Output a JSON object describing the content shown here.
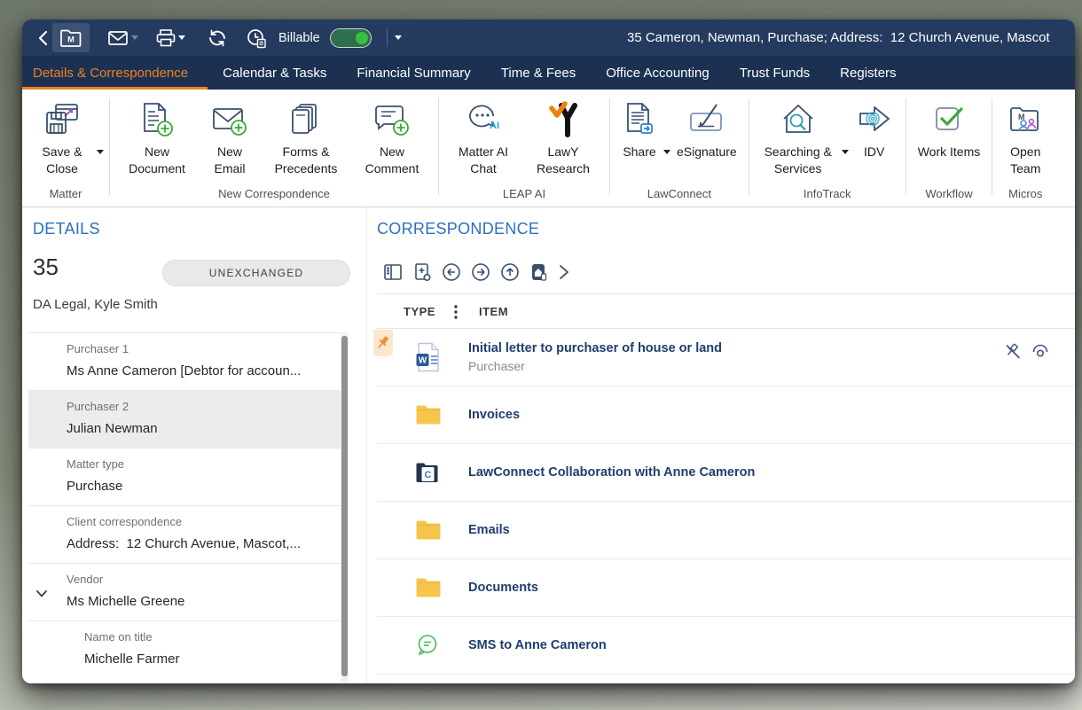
{
  "window": {
    "title": "35 Cameron, Newman, Purchase; Address:  12 Church Avenue, Mascot"
  },
  "titlebar": {
    "billable_label": "Billable",
    "billable_on": true,
    "icons": [
      "back-icon",
      "matter-folder-icon",
      "email-icon",
      "print-icon",
      "refresh-icon",
      "time-billing-icon"
    ]
  },
  "tabs": {
    "items": [
      {
        "label": "Details & Correspondence",
        "active": true
      },
      {
        "label": "Calendar & Tasks",
        "active": false
      },
      {
        "label": "Financial Summary",
        "active": false
      },
      {
        "label": "Time & Fees",
        "active": false
      },
      {
        "label": "Office Accounting",
        "active": false
      },
      {
        "label": "Trust Funds",
        "active": false
      },
      {
        "label": "Registers",
        "active": false
      }
    ]
  },
  "ribbon": {
    "buttons": {
      "save_close": "Save & Close",
      "new_document": "New Document",
      "new_email": "New Email",
      "forms_precedents": "Forms & Precedents",
      "new_comment": "New Comment",
      "matter_ai_chat": "Matter AI Chat",
      "lawy_research": "LawY Research",
      "share": "Share",
      "esignature": "eSignature",
      "searching_services": "Searching & Services",
      "idv": "IDV",
      "work_items": "Work Items",
      "open_team": "Open Team"
    },
    "groups": {
      "matter": "Matter",
      "new_correspondence": "New Correspondence",
      "leap_ai": "LEAP AI",
      "lawconnect": "LawConnect",
      "infotrack": "InfoTrack",
      "workflow": "Workflow",
      "microsoft": "Micros"
    }
  },
  "details": {
    "heading": "DETAILS",
    "matter_number": "35",
    "status_badge": "UNEXCHANGED",
    "staff": "DA Legal, Kyle Smith",
    "fields": [
      {
        "label": "Purchaser 1",
        "value": "Ms Anne Cameron [Debtor for accoun...",
        "highlighted": false
      },
      {
        "label": "Purchaser 2",
        "value": "Julian Newman",
        "highlighted": true
      },
      {
        "label": "Matter type",
        "value": "Purchase",
        "highlighted": false
      },
      {
        "label": "Client correspondence",
        "value": "Address:  12 Church Avenue, Mascot,...",
        "highlighted": false
      },
      {
        "label": "Vendor",
        "value": "Ms Michelle Greene",
        "expandable": true
      },
      {
        "label": "Name on title",
        "value": "Michelle Farmer",
        "indented": true
      }
    ]
  },
  "correspondence": {
    "heading": "CORRESPONDENCE",
    "toolbar_icons": [
      "layout-view-icon",
      "new-folder-icon",
      "navigate-back-icon",
      "navigate-forward-icon",
      "move-up-icon",
      "home-folder-icon",
      "expand-toolbar-icon"
    ],
    "columns": {
      "type": "TYPE",
      "item": "ITEM"
    },
    "rows": [
      {
        "icon": "word-document-icon",
        "title": "Initial letter to purchaser of house or land",
        "subtitle": "Purchaser",
        "pinned": true
      },
      {
        "icon": "folder-icon",
        "title": "Invoices"
      },
      {
        "icon": "lawconnect-folder-icon",
        "title": "LawConnect Collaboration with Anne Cameron"
      },
      {
        "icon": "folder-icon",
        "title": "Emails"
      },
      {
        "icon": "folder-icon",
        "title": "Documents"
      },
      {
        "icon": "sms-icon",
        "title": "SMS to Anne Cameron"
      }
    ]
  },
  "colors": {
    "titlebar_navy": "#243A5E",
    "tabbar_navy": "#1C3152",
    "accent_orange": "#EF8122",
    "heading_blue": "#2A70C2",
    "item_title_navy": "#1F3E6E",
    "green_accent": "#3BA935",
    "folder_yellow": "#F6C64B",
    "toggle_green": "#35C13D",
    "word_blue": "#2B579A"
  }
}
